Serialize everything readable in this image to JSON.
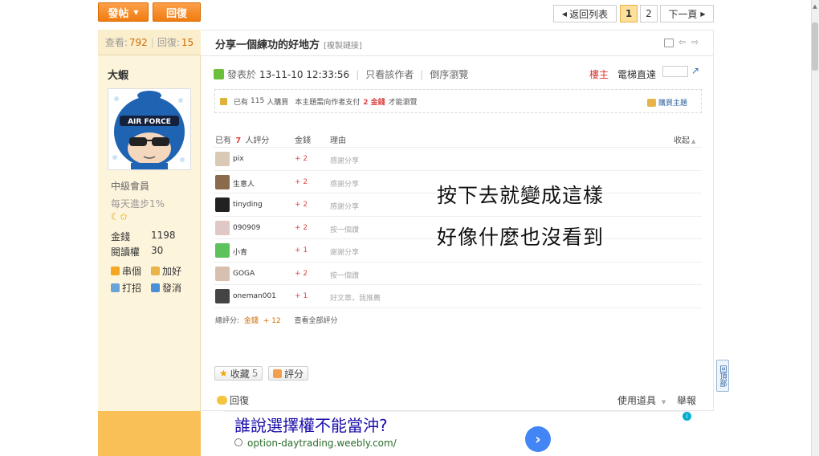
{
  "toolbar": {
    "post_label": "發帖",
    "reply_label": "回復"
  },
  "pager": {
    "back_label": "返回列表",
    "pages": [
      "1",
      "2"
    ],
    "next_label": "下一頁"
  },
  "stats": {
    "views_label": "查看:",
    "views": "792",
    "replies_label": "回復:",
    "replies": "15"
  },
  "author": {
    "name": "大蝦",
    "avatar_text": "AIR FORCE",
    "rank": "中級會員",
    "rank_sub": "每天進步1%",
    "gold_label": "金錢",
    "gold": "1198",
    "read_label": "閱讀權",
    "read": "30",
    "links": {
      "visit": "串個",
      "add_friend": "加好",
      "poke": "打招",
      "message": "發消"
    }
  },
  "post": {
    "title": "分享一個練功的好地方",
    "copy_link": "[複製鏈接]",
    "posted_prefix": "發表於",
    "posted_time": "13-11-10 12:33:56",
    "author_only": "只看該作者",
    "reverse": "倒序瀏覽",
    "floor": "樓主",
    "elevator": "電梯直達"
  },
  "purchase": {
    "text_a": "已有",
    "buyers": "115",
    "text_b": "人購買",
    "text_c": "本主題需向作者支付",
    "price": "2 金錢",
    "text_d": "才能瀏覽",
    "buy_label": "購買主題"
  },
  "ratings": {
    "head_prefix": "已有",
    "head_count": "7",
    "head_suffix": "人評分",
    "col_gold": "金錢",
    "col_reason": "理由",
    "collapse": "收起",
    "rows": [
      {
        "name": "pix",
        "gold": "+ 2",
        "reason": "感謝分享"
      },
      {
        "name": "生意人",
        "gold": "+ 2",
        "reason": "感謝分享"
      },
      {
        "name": "tinyding",
        "gold": "+ 2",
        "reason": "感謝分享"
      },
      {
        "name": "090909",
        "gold": "+ 2",
        "reason": "按一個讚"
      },
      {
        "name": "小青",
        "gold": "+ 1",
        "reason": "謝謝分享"
      },
      {
        "name": "GOGA",
        "gold": "+ 2",
        "reason": "按一個讚"
      },
      {
        "name": "oneman001",
        "gold": "+ 1",
        "reason": "好文章，我推薦"
      }
    ],
    "total_label": "總評分:",
    "total_gold_label": "金錢",
    "total_value": "+ 12",
    "view_all": "查看全部評分"
  },
  "overlay": {
    "line1": "按下去就變成這樣",
    "line2": "好像什麼也沒看到"
  },
  "actions": {
    "favorite_label": "收藏",
    "favorite_count": "5",
    "rate_label": "評分",
    "reply_label": "回復",
    "tools_label": "使用道具",
    "report_label": "舉報"
  },
  "ad": {
    "title": "誰說選擇權不能當沖?",
    "url": "option-daytrading.weebly.com/"
  },
  "back_top_label": "回頂部"
}
